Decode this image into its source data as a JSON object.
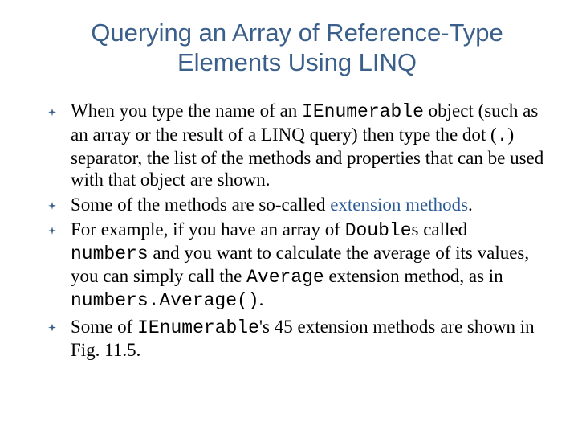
{
  "title_line1": "Querying an Array of Reference-Type",
  "title_line2": "Elements Using LINQ",
  "bullets": {
    "b1": {
      "t1": "When you type the name of an ",
      "code1": "IEnumerable",
      "t2": " object (such as an array or the result of a LINQ query) then type the dot (",
      "code2": ".",
      "t3": ") separator, the list of the methods and properties that can be used with that object are shown."
    },
    "b2": {
      "t1": "Some of the methods are so-called ",
      "term": "extension methods",
      "t2": "."
    },
    "b3": {
      "t1": "For example, if you have an array of ",
      "code1": "Double",
      "t2": "s called ",
      "code2": "numbers",
      "t3": " and you want to calculate the average of its values, you can simply call the ",
      "code3": "Average",
      "t4": " extension method, as in ",
      "code4": "numbers.Average()",
      "t5": "."
    },
    "b4": {
      "t1": "Some of ",
      "code1": "IEnumerable",
      "t2": "'s 45 extension methods are shown in Fig. 11.5."
    }
  }
}
